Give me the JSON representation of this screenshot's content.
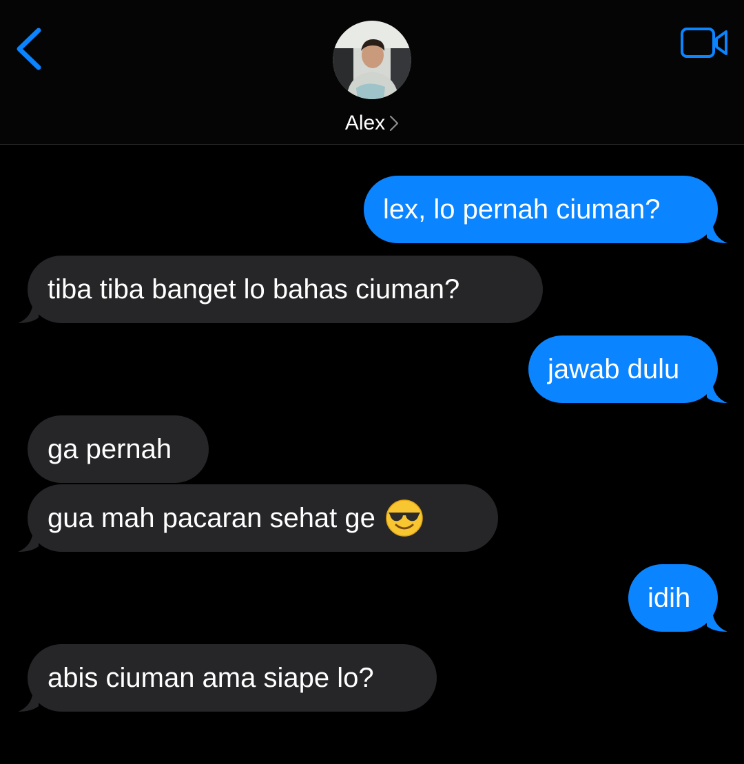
{
  "header": {
    "contact_name": "Alex",
    "avatar": "contact-photo",
    "back_icon": "chevron-left-icon",
    "video_icon": "video-camera-icon",
    "accent_color": "#0b84ff"
  },
  "messages": [
    {
      "direction": "outgoing",
      "text": "lex, lo pernah ciuman?"
    },
    {
      "direction": "incoming",
      "text": "tiba tiba banget lo bahas ciuman?"
    },
    {
      "direction": "outgoing",
      "text": "jawab dulu"
    },
    {
      "direction": "incoming",
      "text": "ga pernah"
    },
    {
      "direction": "incoming",
      "text": "gua mah pacaran sehat ge",
      "emoji": "smiling-face-with-sunglasses"
    },
    {
      "direction": "outgoing",
      "text": "idih"
    },
    {
      "direction": "incoming",
      "text": "abis ciuman ama siape lo?"
    }
  ],
  "colors": {
    "outgoing_bubble": "#0b84ff",
    "incoming_bubble": "#262628",
    "background": "#000000"
  }
}
